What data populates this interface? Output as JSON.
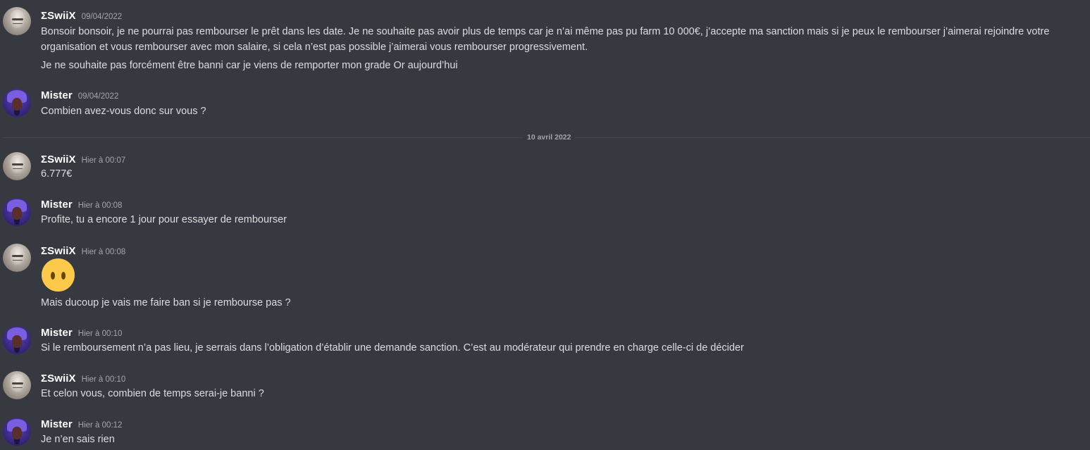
{
  "messages": [
    {
      "author": "ΣSwiiX",
      "timestamp": "09/04/2022",
      "lines": [
        "Bonsoir bonsoir, je ne pourrai pas rembourser le prêt dans les date. Je ne souhaite pas avoir plus de temps car je n’ai même pas pu farm 10 000€, j’accepte ma sanction mais si je peux le rembourser j’aimerai rejoindre votre",
        "organisation et vous rembourser avec mon salaire, si cela n’est pas possible j’aimerai vous rembourser progressivement.",
        "Je ne souhaite pas forcément être banni car je viens de remporter mon grade Or aujourd’hui"
      ]
    },
    {
      "author": "Mister",
      "timestamp": "09/04/2022",
      "lines": [
        "Combien avez-vous donc sur vous ?"
      ]
    },
    {
      "author": "ΣSwiiX",
      "timestamp": "Hier à 00:07",
      "lines": [
        "6.777€"
      ]
    },
    {
      "author": "Mister",
      "timestamp": "Hier à 00:08",
      "lines": [
        "Profite, tu a encore 1 jour pour essayer de rembourser"
      ]
    },
    {
      "author": "ΣSwiiX",
      "timestamp": "Hier à 00:08",
      "emoji": "no-mouth-face-emoji",
      "lines": [
        "Mais ducoup je vais me faire ban si je rembourse pas ?"
      ]
    },
    {
      "author": "Mister",
      "timestamp": "Hier à 00:10",
      "lines": [
        "Si le remboursement n’a pas lieu, je serrais dans l’obligation d’établir une demande sanction. C’est au modérateur qui prendre en charge celle-ci de décider"
      ]
    },
    {
      "author": "ΣSwiiX",
      "timestamp": "Hier à 00:10",
      "lines": [
        "Et celon vous, combien de temps serai-je banni ?"
      ]
    },
    {
      "author": "Mister",
      "timestamp": "Hier à 00:12",
      "lines": [
        "Je n’en sais rien"
      ]
    }
  ],
  "date_divider": {
    "label": "10 avril 2022"
  },
  "colors": {
    "background": "#36393f",
    "author": "#ffffff",
    "message_text": "#dcddde",
    "timestamp": "#a3a6aa"
  }
}
